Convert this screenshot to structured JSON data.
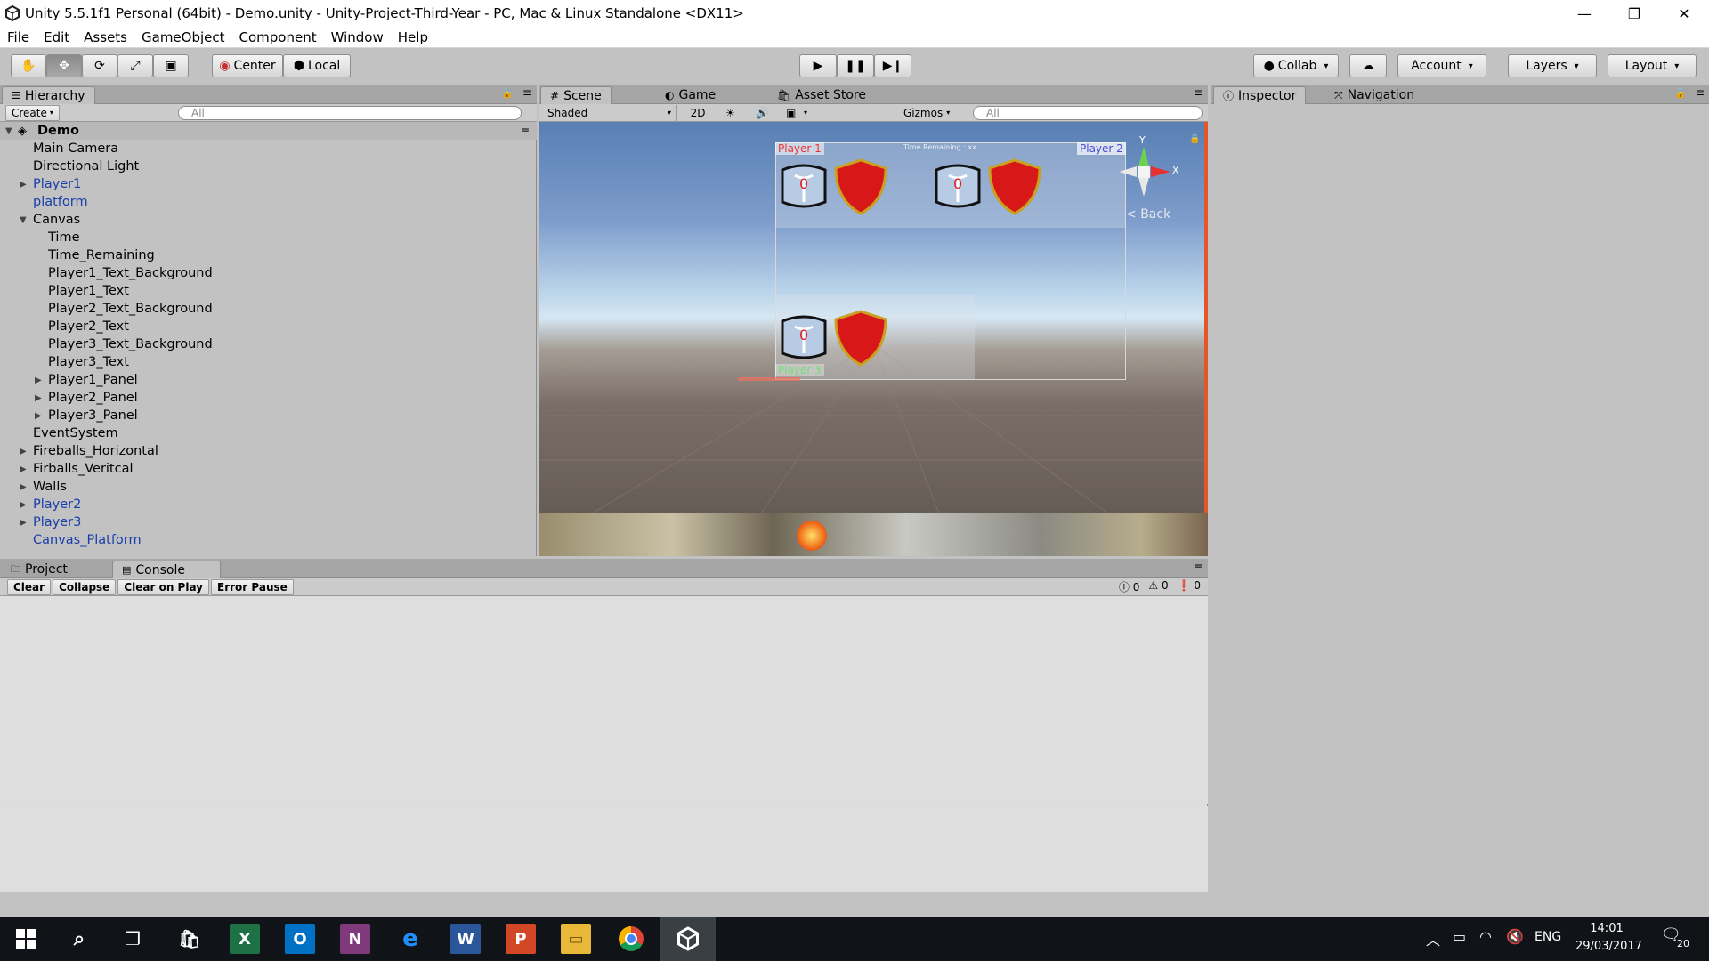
{
  "window": {
    "title": "Unity 5.5.1f1 Personal (64bit) - Demo.unity - Unity-Project-Third-Year - PC, Mac & Linux Standalone <DX11>",
    "minimize": "—",
    "maximize": "❐",
    "close": "✕"
  },
  "menu": [
    "File",
    "Edit",
    "Assets",
    "GameObject",
    "Component",
    "Window",
    "Help"
  ],
  "toolbar": {
    "pivot_center": "Center",
    "pivot_local": "Local",
    "collab": "Collab",
    "account": "Account",
    "layers": "Layers",
    "layout": "Layout"
  },
  "hierarchy": {
    "tab": "Hierarchy",
    "create": "Create",
    "search_placeholder": "All",
    "scene_name": "Demo",
    "items": [
      {
        "label": "Main Camera",
        "indent": 1,
        "arrow": "",
        "prefab": false
      },
      {
        "label": "Directional Light",
        "indent": 1,
        "arrow": "",
        "prefab": false
      },
      {
        "label": "Player1",
        "indent": 1,
        "arrow": "▶",
        "prefab": true
      },
      {
        "label": "platform",
        "indent": 1,
        "arrow": "",
        "prefab": true
      },
      {
        "label": "Canvas",
        "indent": 1,
        "arrow": "▼",
        "prefab": false
      },
      {
        "label": "Time",
        "indent": 2,
        "arrow": "",
        "prefab": false
      },
      {
        "label": "Time_Remaining",
        "indent": 2,
        "arrow": "",
        "prefab": false
      },
      {
        "label": "Player1_Text_Background",
        "indent": 2,
        "arrow": "",
        "prefab": false
      },
      {
        "label": "Player1_Text",
        "indent": 2,
        "arrow": "",
        "prefab": false
      },
      {
        "label": "Player2_Text_Background",
        "indent": 2,
        "arrow": "",
        "prefab": false
      },
      {
        "label": "Player2_Text",
        "indent": 2,
        "arrow": "",
        "prefab": false
      },
      {
        "label": "Player3_Text_Background",
        "indent": 2,
        "arrow": "",
        "prefab": false
      },
      {
        "label": "Player3_Text",
        "indent": 2,
        "arrow": "",
        "prefab": false
      },
      {
        "label": "Player1_Panel",
        "indent": 2,
        "arrow": "▶",
        "prefab": false
      },
      {
        "label": "Player2_Panel",
        "indent": 2,
        "arrow": "▶",
        "prefab": false
      },
      {
        "label": "Player3_Panel",
        "indent": 2,
        "arrow": "▶",
        "prefab": false
      },
      {
        "label": "EventSystem",
        "indent": 1,
        "arrow": "",
        "prefab": false
      },
      {
        "label": "Fireballs_Horizontal",
        "indent": 1,
        "arrow": "▶",
        "prefab": false
      },
      {
        "label": "Firballs_Veritcal",
        "indent": 1,
        "arrow": "▶",
        "prefab": false
      },
      {
        "label": "Walls",
        "indent": 1,
        "arrow": "▶",
        "prefab": false
      },
      {
        "label": "Player2",
        "indent": 1,
        "arrow": "▶",
        "prefab": true
      },
      {
        "label": "Player3",
        "indent": 1,
        "arrow": "▶",
        "prefab": true
      },
      {
        "label": "Canvas_Platform",
        "indent": 1,
        "arrow": "",
        "prefab": true
      }
    ]
  },
  "scene": {
    "tabs": [
      "Scene",
      "Game",
      "Asset Store"
    ],
    "shading": "Shaded",
    "mode_2d": "2D",
    "gizmos": "Gizmos",
    "search_placeholder": "All",
    "player1_label": "Player 1",
    "player2_label": "Player 2",
    "player3_label": "Player 3",
    "time_label": "Time Remaining : xx",
    "score": "0",
    "back_label": "Back",
    "axis_y": "Y",
    "axis_x": "X"
  },
  "console": {
    "tabs": [
      "Project",
      "Console"
    ],
    "buttons": [
      "Clear",
      "Collapse",
      "Clear on Play",
      "Error Pause"
    ],
    "info_count": "0",
    "warning_count": "0",
    "error_count": "0"
  },
  "inspector": {
    "tabs": [
      "Inspector",
      "Navigation"
    ]
  },
  "taskbar": {
    "language": "ENG",
    "time": "14:01",
    "date": "29/03/2017",
    "notifications": "20",
    "apps": [
      {
        "name": "start-icon"
      },
      {
        "name": "search-icon"
      },
      {
        "name": "task-view-icon"
      },
      {
        "name": "store-icon"
      },
      {
        "name": "excel-icon"
      },
      {
        "name": "outlook-icon"
      },
      {
        "name": "onenote-icon"
      },
      {
        "name": "edge-icon"
      },
      {
        "name": "word-icon"
      },
      {
        "name": "powerpoint-icon"
      },
      {
        "name": "file-explorer-icon"
      },
      {
        "name": "chrome-icon"
      },
      {
        "name": "unity-icon"
      }
    ]
  }
}
